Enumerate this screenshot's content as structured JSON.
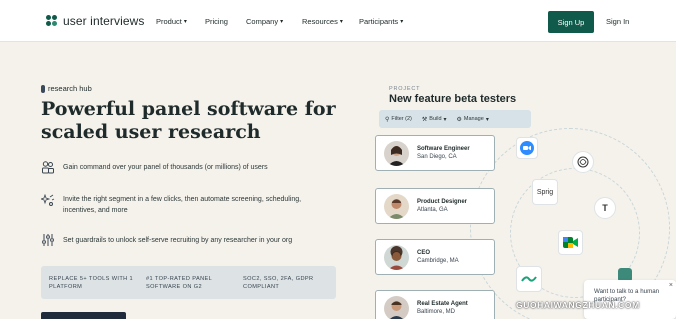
{
  "brand": {
    "name": "user interviews",
    "color": "#0f5a4a"
  },
  "nav": {
    "items": [
      {
        "label": "Product",
        "has_caret": true
      },
      {
        "label": "Pricing",
        "has_caret": false
      },
      {
        "label": "Company",
        "has_caret": true
      },
      {
        "label": "Resources",
        "has_caret": true
      },
      {
        "label": "Participants",
        "has_caret": true
      }
    ],
    "signup_label": "Sign Up",
    "signin_label": "Sign In"
  },
  "hero": {
    "eyebrow": "research hub",
    "headline": "Powerful panel software for scaled user research",
    "features": [
      {
        "icon": "people-icon",
        "text": "Gain command over your panel of thousands (or millions) of users"
      },
      {
        "icon": "sparkle-icon",
        "text": "Invite the right segment in a few clicks, then automate screening, scheduling, incentives, and more"
      },
      {
        "icon": "sliders-icon",
        "text": "Set guardrails to unlock self-serve recruiting by any researcher in your org"
      }
    ],
    "stats": [
      "Replace 5+ tools with 1 platform",
      "#1 top-rated panel software on G2",
      "SOC2, SSO, 2FA, GDPR compliant"
    ]
  },
  "project": {
    "label": "PROJECT",
    "title": "New feature beta testers",
    "toolbar": [
      {
        "icon": "filter-icon",
        "label": "Filter (2)"
      },
      {
        "icon": "build-icon",
        "label": "Build"
      },
      {
        "icon": "gear-icon",
        "label": "Manage"
      }
    ],
    "participants": [
      {
        "name": "Software Engineer",
        "location": "San Diego, CA"
      },
      {
        "name": "Product Designer",
        "location": "Atlanta, GA"
      },
      {
        "name": "CEO",
        "location": "Cambridge, MA"
      },
      {
        "name": "Real Estate Agent",
        "location": "Baltimore, MD"
      }
    ],
    "integrations": [
      {
        "icon": "zoom-icon",
        "label": ""
      },
      {
        "icon": "chatgpt-icon",
        "label": ""
      },
      {
        "icon": "sprig-icon",
        "label": "Sprig"
      },
      {
        "icon": "typeform-icon",
        "label": "T"
      },
      {
        "icon": "google-meet-icon",
        "label": ""
      },
      {
        "icon": "tilde-icon",
        "label": ""
      }
    ]
  },
  "chat": {
    "text": "Want to talk to a human participant?",
    "close": "×"
  },
  "watermark": "GUOHAIWANGZHUAN.COM"
}
